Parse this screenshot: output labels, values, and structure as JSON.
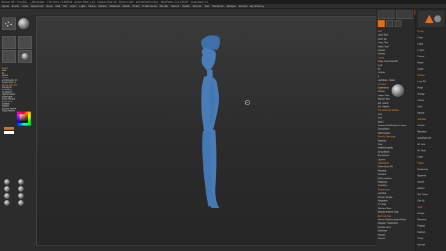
{
  "titlebar": {
    "text": "ZBrush 4R7 P3 (x64) _ :_ZBrushDoc · Free Mem 13.838GB · Active Mem 1.12 · Scratch Disk 48 · Timer 0.008 · ActivePoints 0.614 · TotalPoints 170.269 KP · QuickSave 4.1"
  },
  "menus": [
    "Alpha",
    "Brush",
    "Color",
    "Document",
    "Draw",
    "Edit",
    "File",
    "Layer",
    "Light",
    "Macro",
    "Marker",
    "Material",
    "Movie",
    "Picker",
    "Preferences",
    "Render",
    "Stencil",
    "Stroke",
    "Texture",
    "Tool",
    "Transform",
    "Zplugin",
    "Zscript",
    "Zp_Sharing"
  ],
  "viewport": {
    "figure_color": "#4a7db8",
    "background_top": "#3a3a3a",
    "background_bottom": "#262626"
  },
  "left": {
    "labels": [
      "Mrgb",
      "Rgb",
      "M",
      "Zadd",
      "Zsub",
      "Z Intensity 25",
      "Focal Shift 0",
      "Draw Size 64",
      "Dynamic",
      "LightBox",
      "Gradient",
      "SwitchColor",
      "Alternate",
      "Lazy Mouse",
      "Backface",
      "Flatten",
      "Morph",
      "Active Points",
      "Total Points"
    ],
    "material_spheres": 8
  },
  "right1": {
    "labels": [
      "Tool",
      "Load Tool",
      "Save As",
      "Copy Tool",
      "Paste Tool",
      "Import",
      "Export",
      "Clone",
      "Make PolyMesh3D",
      "GoZ",
      "All",
      "Visible",
      "R",
      "Lightbox › Tools",
      "Subtool",
      "Geometry",
      "Divide",
      "Lower Res",
      "Higher Res",
      "Del Lower",
      "Del Higher",
      "Reconstruct Subdiv",
      "Smt",
      "Suv",
      "ReUV",
      "Freeze SubDivision Levels",
      "DynaMesh",
      "ZRemesher",
      "Modify Topology",
      "Position",
      "Size",
      "MeshIntegrity",
      "ArrayMesh",
      "NanoMesh",
      "Layers",
      "FiberMesh",
      "Geometry HD",
      "Preview",
      "Surface",
      "Deformation",
      "Masking",
      "Visibility",
      "Polygroups",
      "Contact",
      "Morph Target",
      "Polypaint",
      "UV Map",
      "Texture Map",
      "Displacement Map",
      "Normal Map",
      "Vector Displacement Map",
      "Display Properties",
      "Unified Skin",
      "Initialize",
      "Import",
      "Export"
    ]
  },
  "right2": {
    "labels": [
      "Persp",
      "Floor",
      "Local",
      "L.Sym",
      "Frame",
      "Move",
      "Scale",
      "Rotate",
      "Line Fill",
      "PolyF",
      "Transp",
      "Ghost",
      "Solo",
      "Xpose",
      "SubTool",
      "Visible",
      "Rename",
      "AutoReorder",
      "All Low",
      "All High",
      "Copy",
      "Paste",
      "Duplicate",
      "Append",
      "Insert",
      "Delete",
      "Del Other",
      "Del All",
      "Split",
      "Merge",
      "Remesh",
      "Project",
      "Extract",
      "Thick",
      "Accept"
    ]
  },
  "colors": {
    "accent": "#e07020",
    "panel": "#2c2c2c",
    "figure": "#4a7db8"
  }
}
